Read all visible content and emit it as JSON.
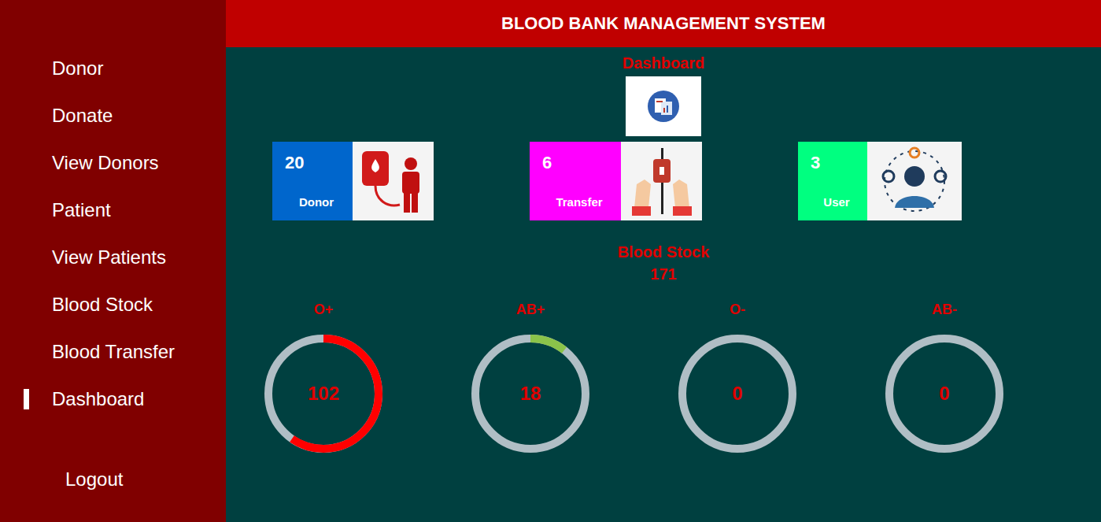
{
  "header": {
    "title": "BLOOD BANK MANAGEMENT SYSTEM"
  },
  "sidebar": {
    "items": [
      {
        "label": "Donor",
        "selected": false
      },
      {
        "label": "Donate",
        "selected": false
      },
      {
        "label": "View Donors",
        "selected": false
      },
      {
        "label": "Patient",
        "selected": false
      },
      {
        "label": "View Patients",
        "selected": false
      },
      {
        "label": "Blood Stock",
        "selected": false
      },
      {
        "label": "Blood Transfer",
        "selected": false
      },
      {
        "label": "Dashboard",
        "selected": true
      }
    ],
    "logout": "Logout"
  },
  "dashboard": {
    "title": "Dashboard"
  },
  "cards": [
    {
      "count": "20",
      "label": "Donor",
      "color": "#0066cc",
      "kind": "donor"
    },
    {
      "count": "6",
      "label": "Transfer",
      "color": "#ff00ff",
      "kind": "transfer"
    },
    {
      "count": "3",
      "label": "User",
      "color": "#00ff80",
      "kind": "user"
    }
  ],
  "stock": {
    "title": "Blood Stock",
    "total": "171",
    "groups": [
      {
        "label": "O+",
        "value": "102",
        "level": 0.596,
        "color": "#ff0000"
      },
      {
        "label": "AB+",
        "value": "18",
        "level": 0.105,
        "color": "#8bc34a"
      },
      {
        "label": "O-",
        "value": "0",
        "level": 0,
        "color": "#ff0000"
      },
      {
        "label": "AB-",
        "value": "0",
        "level": 0,
        "color": "#ff0000"
      }
    ]
  }
}
